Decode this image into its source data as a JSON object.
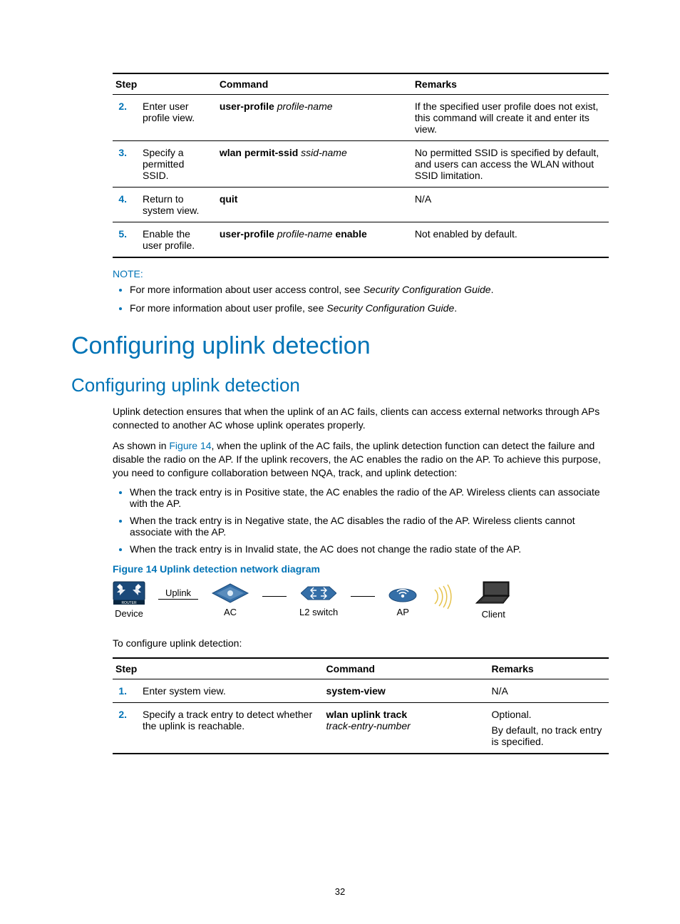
{
  "table1": {
    "headers": [
      "Step",
      "Command",
      "Remarks"
    ],
    "rows": [
      {
        "num": "2.",
        "step": "Enter user profile view.",
        "cmd_bold1": "user-profile",
        "cmd_ital1": " profile-name",
        "remarks": "If the specified user profile does not exist, this command will create it and enter its view."
      },
      {
        "num": "3.",
        "step": "Specify a permitted SSID.",
        "cmd_bold1": "wlan permit-ssid",
        "cmd_ital1": " ssid-name",
        "remarks": "No permitted SSID is specified by default, and users can access the WLAN without SSID limitation."
      },
      {
        "num": "4.",
        "step": "Return to system view.",
        "cmd_bold1": "quit",
        "cmd_ital1": "",
        "remarks": "N/A"
      },
      {
        "num": "5.",
        "step": "Enable the user profile.",
        "cmd_bold1": "user-profile",
        "cmd_ital1": " profile-name ",
        "cmd_bold2": "enable",
        "remarks": "Not enabled by default."
      }
    ]
  },
  "note": {
    "label": "NOTE:",
    "items": [
      {
        "text_pre": "For more information about user access control, see ",
        "text_ital": "Security Configuration Guide",
        "text_post": "."
      },
      {
        "text_pre": "For more information about user profile, see ",
        "text_ital": "Security Configuration Guide",
        "text_post": "."
      }
    ]
  },
  "h1": "Configuring uplink detection",
  "h2": "Configuring uplink detection",
  "para1": "Uplink detection ensures that when the uplink of an AC fails, clients can access external networks through APs connected to another AC whose uplink operates properly.",
  "para2_pre": "As shown in ",
  "para2_link": "Figure 14",
  "para2_post": ", when the uplink of the AC fails, the uplink detection function can detect the failure and disable the radio on the AP. If the uplink recovers, the AC enables the radio on the AP. To achieve this purpose, you need to configure collaboration between NQA, track, and uplink detection:",
  "bullets": [
    "When the track entry is in Positive state, the AC enables the radio of the AP. Wireless clients can associate with the AP.",
    "When the track entry is in Negative state, the AC disables the radio of the AP. Wireless clients cannot associate with the AP.",
    "When the track entry is in Invalid state, the AC does not change the radio state of the AP."
  ],
  "fig_caption": "Figure 14 Uplink detection network diagram",
  "diagram": {
    "uplink": "Uplink",
    "device": "Device",
    "router_tag": "ROUTER",
    "ac": "AC",
    "l2": "L2 switch",
    "ap": "AP",
    "client": "Client"
  },
  "para3": "To configure uplink detection:",
  "table2": {
    "headers": [
      "Step",
      "Command",
      "Remarks"
    ],
    "rows": [
      {
        "num": "1.",
        "step": "Enter system view.",
        "cmd_bold1": "system-view",
        "cmd_ital1": "",
        "remarks": "N/A"
      },
      {
        "num": "2.",
        "step": "Specify a track entry to detect whether the uplink is reachable.",
        "cmd_bold1": "wlan uplink track",
        "cmd_ital1": " track-entry-number",
        "remarks_line1": "Optional.",
        "remarks_line2": "By default, no track entry is specified."
      }
    ]
  },
  "page_number": "32"
}
